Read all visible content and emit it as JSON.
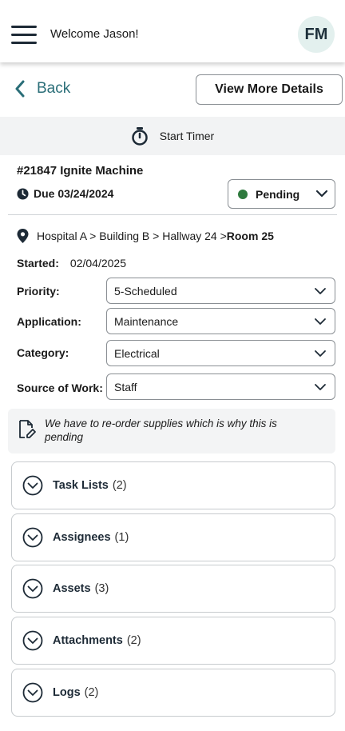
{
  "header": {
    "welcome": "Welcome Jason!",
    "avatar_initials": "FM",
    "menu_icon": "hamburger-menu-icon"
  },
  "nav": {
    "back_label": "Back",
    "view_more_label": "View More Details"
  },
  "timer": {
    "label": "Start Timer",
    "icon": "stopwatch-icon"
  },
  "work_order": {
    "title": "#21847 Ignite Machine",
    "due": "Due 03/24/2024",
    "status": "Pending",
    "status_color": "#2f7a3e"
  },
  "location": {
    "path": "Hospital A > Building B > Hallway 24 > ",
    "room": "Room 25"
  },
  "started": {
    "label": "Started:",
    "value": "02/04/2025"
  },
  "fields": {
    "priority": {
      "label": "Priority:",
      "value": "5-Scheduled"
    },
    "application": {
      "label": "Application:",
      "value": "Maintenance"
    },
    "category": {
      "label": "Category:",
      "value": "Electrical"
    },
    "source": {
      "label": "Source of Work:",
      "value": "Staff"
    }
  },
  "note": {
    "text": "We have to re-order supplies which is why this is pending"
  },
  "sections": [
    {
      "label": "Task Lists",
      "count": "(2)"
    },
    {
      "label": "Assignees",
      "count": "(1)"
    },
    {
      "label": "Assets",
      "count": "(3)"
    },
    {
      "label": "Attachments",
      "count": "(2)"
    },
    {
      "label": "Logs",
      "count": "(2)"
    }
  ],
  "colors": {
    "accent": "#2a6e78",
    "avatar_bg": "#e3f0ee",
    "timer_bg": "#f2f3f4"
  }
}
